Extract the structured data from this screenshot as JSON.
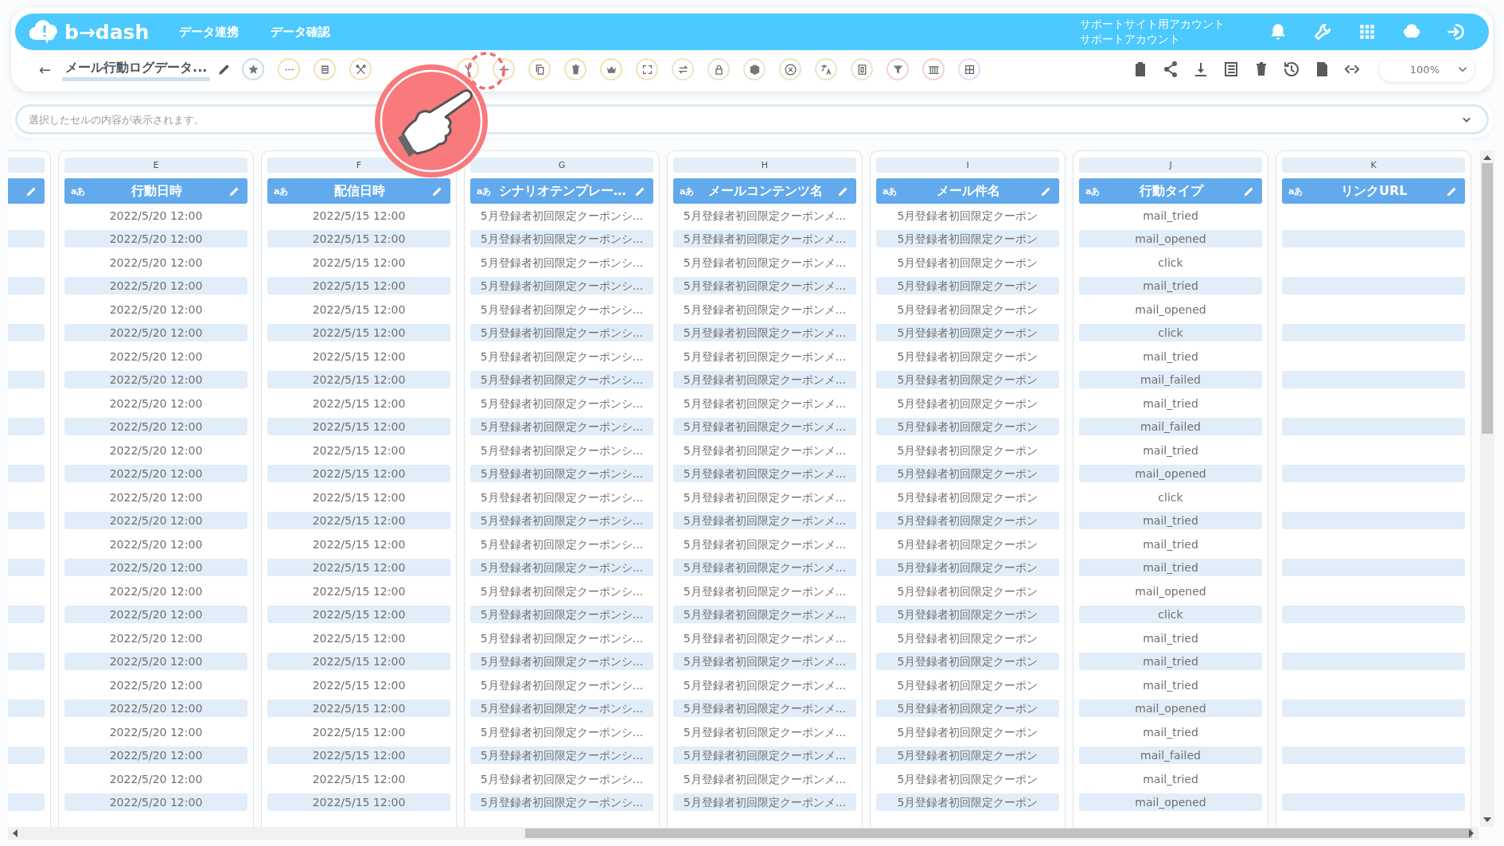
{
  "header": {
    "logo": "b→dash",
    "nav": [
      "データ連携",
      "データ確認"
    ],
    "account": [
      "サポートサイト用アカウント",
      "サポートアカウント"
    ]
  },
  "toolbar": {
    "back": "←",
    "title": "メール行動ログデータ...",
    "zoom": "100%"
  },
  "formula_bar": {
    "placeholder": "選択したセルの内容が表示されます。"
  },
  "columns": [
    {
      "letter": "E",
      "type_label": "aあ",
      "name": "行動日時"
    },
    {
      "letter": "F",
      "type_label": "aあ",
      "name": "配信日時"
    },
    {
      "letter": "G",
      "type_label": "aあ",
      "name": "シナリオテンプレー…"
    },
    {
      "letter": "H",
      "type_label": "aあ",
      "name": "メールコンテンツ名"
    },
    {
      "letter": "I",
      "type_label": "aあ",
      "name": "メール件名"
    },
    {
      "letter": "J",
      "type_label": "aあ",
      "name": "行動タイプ"
    },
    {
      "letter": "K",
      "type_label": "aあ",
      "name": "リンクURL"
    }
  ],
  "rows": [
    [
      "2022/5/20 12:00",
      "2022/5/15 12:00",
      "5月登録者初回限定クーポンシ...",
      "5月登録者初回限定クーポンメ...",
      "5月登録者初回限定クーポン",
      "mail_tried"
    ],
    [
      "2022/5/20 12:00",
      "2022/5/15 12:00",
      "5月登録者初回限定クーポンシ...",
      "5月登録者初回限定クーポンメ...",
      "5月登録者初回限定クーポン",
      "mail_opened"
    ],
    [
      "2022/5/20 12:00",
      "2022/5/15 12:00",
      "5月登録者初回限定クーポンシ...",
      "5月登録者初回限定クーポンメ...",
      "5月登録者初回限定クーポン",
      "click"
    ],
    [
      "2022/5/20 12:00",
      "2022/5/15 12:00",
      "5月登録者初回限定クーポンシ...",
      "5月登録者初回限定クーポンメ...",
      "5月登録者初回限定クーポン",
      "mail_tried"
    ],
    [
      "2022/5/20 12:00",
      "2022/5/15 12:00",
      "5月登録者初回限定クーポンシ...",
      "5月登録者初回限定クーポンメ...",
      "5月登録者初回限定クーポン",
      "mail_opened"
    ],
    [
      "2022/5/20 12:00",
      "2022/5/15 12:00",
      "5月登録者初回限定クーポンシ...",
      "5月登録者初回限定クーポンメ...",
      "5月登録者初回限定クーポン",
      "click"
    ],
    [
      "2022/5/20 12:00",
      "2022/5/15 12:00",
      "5月登録者初回限定クーポンシ...",
      "5月登録者初回限定クーポンメ...",
      "5月登録者初回限定クーポン",
      "mail_tried"
    ],
    [
      "2022/5/20 12:00",
      "2022/5/15 12:00",
      "5月登録者初回限定クーポンシ...",
      "5月登録者初回限定クーポンメ...",
      "5月登録者初回限定クーポン",
      "mail_failed"
    ],
    [
      "2022/5/20 12:00",
      "2022/5/15 12:00",
      "5月登録者初回限定クーポンシ...",
      "5月登録者初回限定クーポンメ...",
      "5月登録者初回限定クーポン",
      "mail_tried"
    ],
    [
      "2022/5/20 12:00",
      "2022/5/15 12:00",
      "5月登録者初回限定クーポンシ...",
      "5月登録者初回限定クーポンメ...",
      "5月登録者初回限定クーポン",
      "mail_failed"
    ],
    [
      "2022/5/20 12:00",
      "2022/5/15 12:00",
      "5月登録者初回限定クーポンシ...",
      "5月登録者初回限定クーポンメ...",
      "5月登録者初回限定クーポン",
      "mail_tried"
    ],
    [
      "2022/5/20 12:00",
      "2022/5/15 12:00",
      "5月登録者初回限定クーポンシ...",
      "5月登録者初回限定クーポンメ...",
      "5月登録者初回限定クーポン",
      "mail_opened"
    ],
    [
      "2022/5/20 12:00",
      "2022/5/15 12:00",
      "5月登録者初回限定クーポンシ...",
      "5月登録者初回限定クーポンメ...",
      "5月登録者初回限定クーポン",
      "click"
    ],
    [
      "2022/5/20 12:00",
      "2022/5/15 12:00",
      "5月登録者初回限定クーポンシ...",
      "5月登録者初回限定クーポンメ...",
      "5月登録者初回限定クーポン",
      "mail_tried"
    ],
    [
      "2022/5/20 12:00",
      "2022/5/15 12:00",
      "5月登録者初回限定クーポンシ...",
      "5月登録者初回限定クーポンメ...",
      "5月登録者初回限定クーポン",
      "mail_tried"
    ],
    [
      "2022/5/20 12:00",
      "2022/5/15 12:00",
      "5月登録者初回限定クーポンシ...",
      "5月登録者初回限定クーポンメ...",
      "5月登録者初回限定クーポン",
      "mail_tried"
    ],
    [
      "2022/5/20 12:00",
      "2022/5/15 12:00",
      "5月登録者初回限定クーポンシ...",
      "5月登録者初回限定クーポンメ...",
      "5月登録者初回限定クーポン",
      "mail_opened"
    ],
    [
      "2022/5/20 12:00",
      "2022/5/15 12:00",
      "5月登録者初回限定クーポンシ...",
      "5月登録者初回限定クーポンメ...",
      "5月登録者初回限定クーポン",
      "click"
    ],
    [
      "2022/5/20 12:00",
      "2022/5/15 12:00",
      "5月登録者初回限定クーポンシ...",
      "5月登録者初回限定クーポンメ...",
      "5月登録者初回限定クーポン",
      "mail_tried"
    ],
    [
      "2022/5/20 12:00",
      "2022/5/15 12:00",
      "5月登録者初回限定クーポンシ...",
      "5月登録者初回限定クーポンメ...",
      "5月登録者初回限定クーポン",
      "mail_tried"
    ],
    [
      "2022/5/20 12:00",
      "2022/5/15 12:00",
      "5月登録者初回限定クーポンシ...",
      "5月登録者初回限定クーポンメ...",
      "5月登録者初回限定クーポン",
      "mail_tried"
    ],
    [
      "2022/5/20 12:00",
      "2022/5/15 12:00",
      "5月登録者初回限定クーポンシ...",
      "5月登録者初回限定クーポンメ...",
      "5月登録者初回限定クーポン",
      "mail_opened"
    ],
    [
      "2022/5/20 12:00",
      "2022/5/15 12:00",
      "5月登録者初回限定クーポンシ...",
      "5月登録者初回限定クーポンメ...",
      "5月登録者初回限定クーポン",
      "mail_tried"
    ],
    [
      "2022/5/20 12:00",
      "2022/5/15 12:00",
      "5月登録者初回限定クーポンシ...",
      "5月登録者初回限定クーポンメ...",
      "5月登録者初回限定クーポン",
      "mail_failed"
    ],
    [
      "2022/5/20 12:00",
      "2022/5/15 12:00",
      "5月登録者初回限定クーポンシ...",
      "5月登録者初回限定クーポンメ...",
      "5月登録者初回限定クーポン",
      "mail_tried"
    ],
    [
      "2022/5/20 12:00",
      "2022/5/15 12:00",
      "5月登録者初回限定クーポンシ...",
      "5月登録者初回限定クーポンメ...",
      "5月登録者初回限定クーポン",
      "mail_opened"
    ]
  ]
}
